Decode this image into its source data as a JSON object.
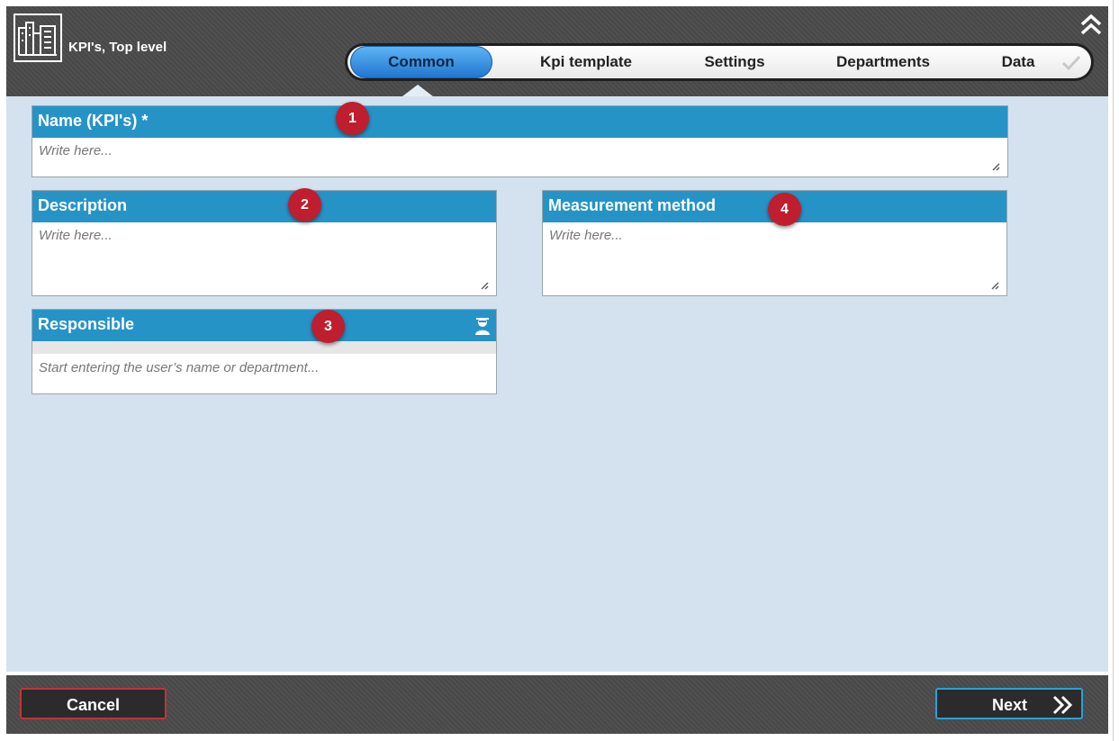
{
  "header": {
    "app_title": "KPI's, Top level",
    "logo_icon": "building-icon",
    "collapse_icon": "double-chevron-up-icon"
  },
  "tabs": [
    {
      "label": "Common",
      "active": true
    },
    {
      "label": "Kpi template",
      "active": false
    },
    {
      "label": "Settings",
      "active": false
    },
    {
      "label": "Departments",
      "active": false
    },
    {
      "label": "Data",
      "active": false
    }
  ],
  "tab_check_icon": "checkmark-icon",
  "form": {
    "name": {
      "label": "Name (KPI's) *",
      "placeholder": "Write here...",
      "badge": "1"
    },
    "description": {
      "label": "Description",
      "placeholder": "Write here...",
      "badge": "2"
    },
    "responsible": {
      "label": "Responsible",
      "placeholder": "Start entering the user’s name or department...",
      "badge": "3",
      "icon": "user-icon"
    },
    "measurement": {
      "label": "Measurement method",
      "placeholder": "Write here...",
      "badge": "4"
    }
  },
  "footer": {
    "cancel_label": "Cancel",
    "next_label": "Next",
    "next_icon": "double-chevron-right-icon"
  },
  "colors": {
    "panel_header": "#2693c7",
    "badge": "#bf1e2e",
    "background": "#d3e2ee",
    "chrome": "#4a4a4a",
    "cancel_border": "#c2333b",
    "next_border": "#2aa0d8"
  }
}
